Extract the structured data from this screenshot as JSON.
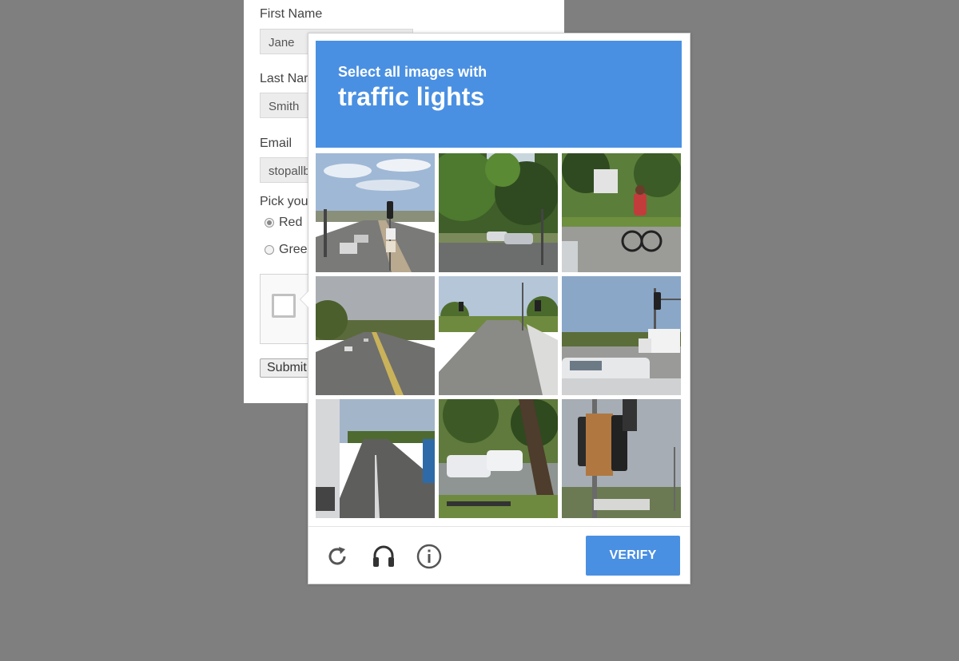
{
  "form": {
    "first_name_label": "First Name",
    "first_name_value": "Jane",
    "last_name_label": "Last Nar",
    "last_name_value": "Smith",
    "email_label": "Email",
    "email_value": "stopallb",
    "pick_label": "Pick you",
    "radio_red": "Red",
    "radio_green": "Greer",
    "submit_label": "Submit"
  },
  "challenge": {
    "instruction": "Select all images with",
    "target": "traffic lights",
    "verify_label": "VERIFY",
    "accent_color": "#4a90e2",
    "footer_icons": [
      "reload-icon",
      "audio-headphones-icon",
      "info-icon"
    ]
  }
}
